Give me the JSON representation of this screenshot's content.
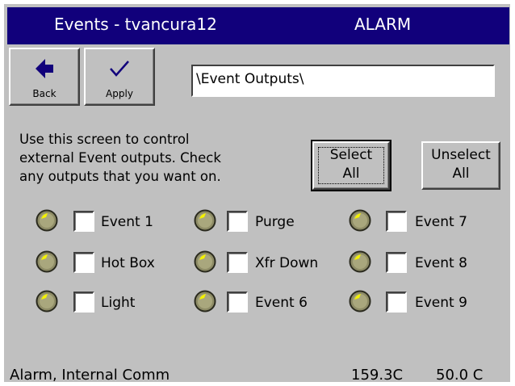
{
  "titlebar": {
    "title": "Events - tvancura12",
    "alarm": "ALARM",
    "bg_color": "#11007b"
  },
  "toolbar": {
    "back_label": "Back",
    "back_icon": "left-arrow-icon",
    "apply_label": "Apply",
    "apply_icon": "checkmark-icon",
    "path_value": "\\Event Outputs\\"
  },
  "instructions": {
    "line1": "Use this screen to control",
    "line2": "external Event outputs.  Check",
    "line3": "any outputs that you want on."
  },
  "buttons": {
    "select_line1": "Select",
    "select_line2": "All",
    "unselect_line1": "Unselect",
    "unselect_line2": "All"
  },
  "events": [
    {
      "label": "Event 1",
      "checked": false,
      "indicator": "led-icon"
    },
    {
      "label": "Hot Box",
      "checked": false,
      "indicator": "led-icon"
    },
    {
      "label": "Light",
      "checked": false,
      "indicator": "led-icon"
    },
    {
      "label": "Purge",
      "checked": false,
      "indicator": "led-icon"
    },
    {
      "label": "Xfr Down",
      "checked": false,
      "indicator": "led-icon"
    },
    {
      "label": "Event 6",
      "checked": false,
      "indicator": "led-icon"
    },
    {
      "label": "Event 7",
      "checked": false,
      "indicator": "led-icon"
    },
    {
      "label": "Event 8",
      "checked": false,
      "indicator": "led-icon"
    },
    {
      "label": "Event 9",
      "checked": false,
      "indicator": "led-icon"
    }
  ],
  "status": {
    "message": "Alarm, Internal Comm",
    "temperature": "159.3C",
    "setpoint": "50.0 C"
  }
}
